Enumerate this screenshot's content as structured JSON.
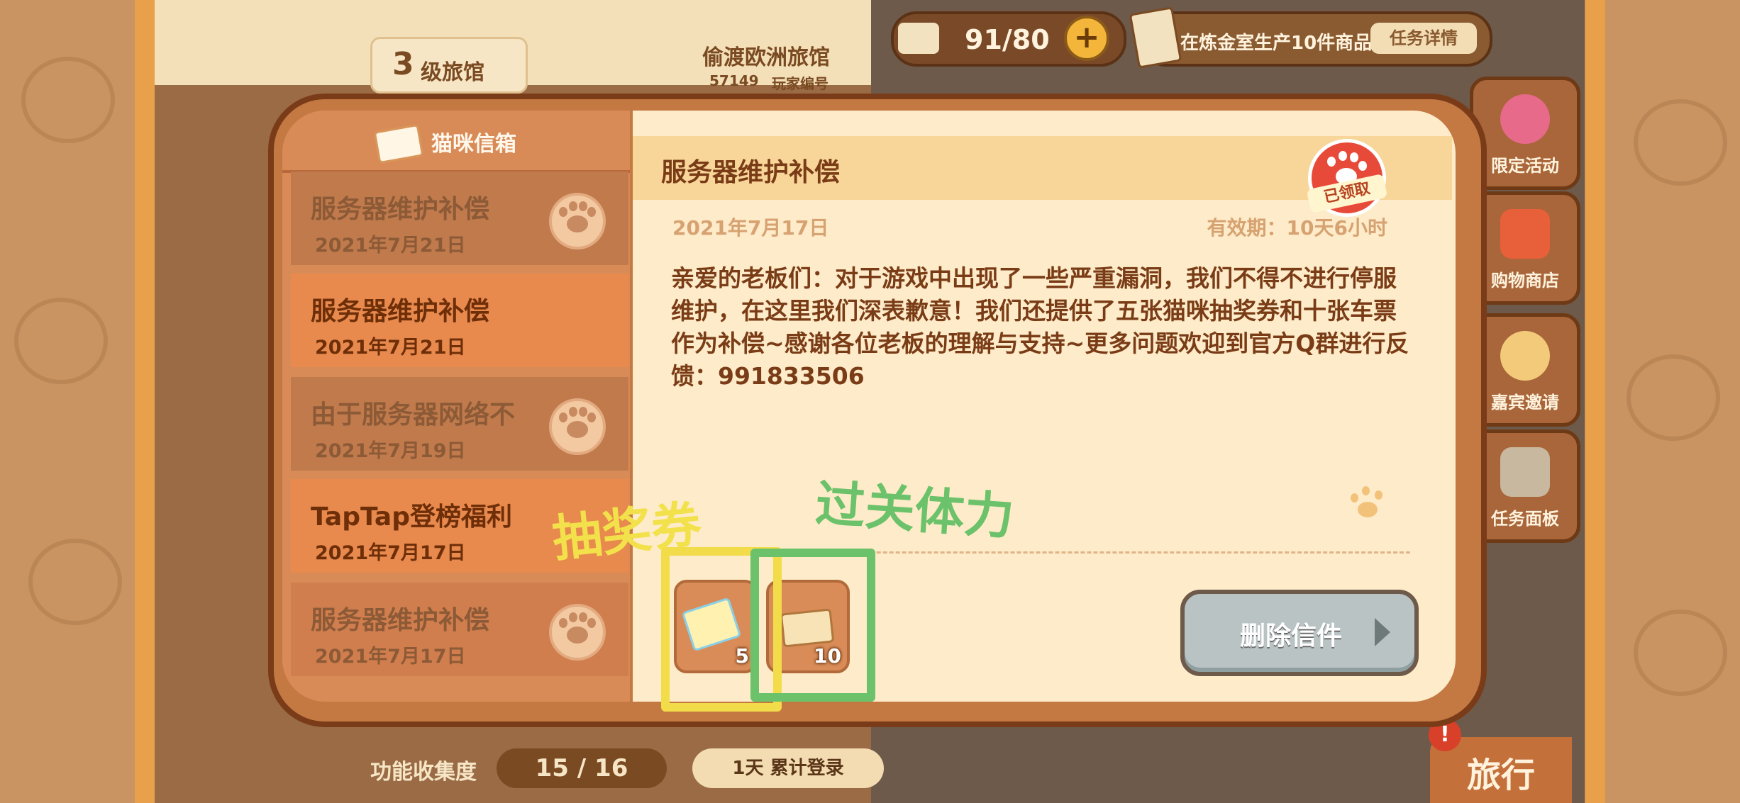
{
  "hud": {
    "stamina": "91/80",
    "task_text": "在炼金室生产10件商品",
    "task_detail_button": "任务详情",
    "plus_icon": "plus-icon"
  },
  "hotel": {
    "level": "3",
    "level_label": "级旅馆",
    "name": "偷渡欧洲旅馆",
    "player_id": "57149",
    "player_id_label": "玩家编号"
  },
  "right_menu": [
    {
      "label": "限定活动",
      "icon": "balloon-icon",
      "color": "#e86a8a"
    },
    {
      "label": "购物商店",
      "icon": "shop-icon",
      "color": "#e8603a"
    },
    {
      "label": "嘉宾邀请",
      "icon": "cat-icon",
      "color": "#f3c97a"
    },
    {
      "label": "任务面板",
      "icon": "board-icon",
      "color": "#c8b8a0"
    }
  ],
  "bottom": {
    "collection_label": "功能收集度",
    "collection_value": "15 / 16",
    "login_text": "1天 累计登录",
    "travel_button": "旅行",
    "alert_icon": "!"
  },
  "mailbox": {
    "title": "猫咪信箱",
    "items": [
      {
        "title": "服务器维护补偿",
        "date": "2021年7月21日",
        "read": true
      },
      {
        "title": "服务器维护补偿",
        "date": "2021年7月21日",
        "read": false
      },
      {
        "title": "由于服务器网络不",
        "date": "2021年7月19日",
        "read": true
      },
      {
        "title": "TapTap登榜福利",
        "date": "2021年7月17日",
        "read": false
      },
      {
        "title": "服务器维护补偿",
        "date": "2021年7月17日",
        "read": true
      }
    ]
  },
  "detail": {
    "title": "服务器维护补偿",
    "claimed_stamp": "已领取",
    "date": "2021年7月17日",
    "validity": "有效期：10天6小时",
    "body": "亲爱的老板们：对于游戏中出现了一些严重漏洞，我们不得不进行停服维护，在这里我们深表歉意！我们还提供了五张猫咪抽奖券和十张车票作为补偿~感谢各位老板的理解与支持~更多问题欢迎到官方Q群进行反馈：991833506",
    "rewards": [
      {
        "icon": "lottery-ticket-icon",
        "count": "5"
      },
      {
        "icon": "paw-ticket-icon",
        "count": "10"
      }
    ],
    "delete_button": "删除信件"
  },
  "annotations": {
    "left_label": "抽奖券",
    "left_color": "#f2e14a",
    "right_label": "过关体力",
    "right_color": "#6cc26a"
  }
}
